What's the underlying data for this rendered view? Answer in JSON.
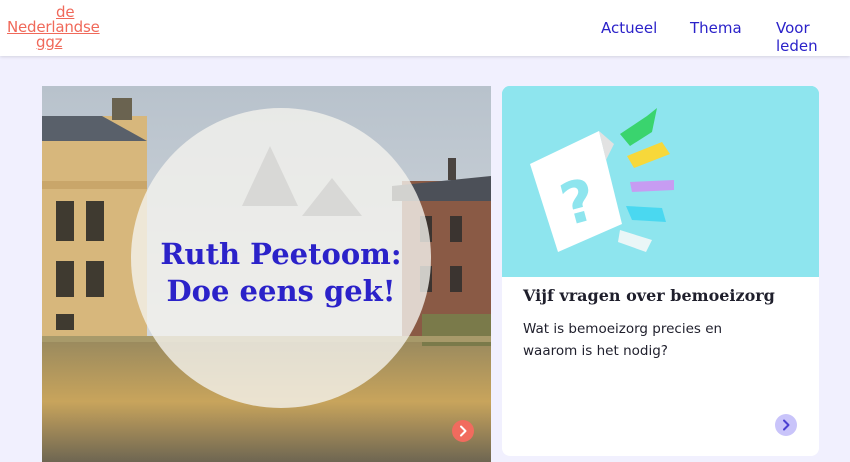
{
  "site": {
    "logo_lines": [
      "de",
      "Nederlandse",
      "ggz"
    ]
  },
  "nav": {
    "items": [
      {
        "label": "Actueel"
      },
      {
        "label": "Thema"
      },
      {
        "label": "Voor leden"
      }
    ]
  },
  "hero": {
    "title": "Ruth Peetoom: Doe eens gek!",
    "arrow_icon": "chevron-right-icon",
    "arrow_color": "#f16b5e"
  },
  "card": {
    "title": "Vijf vragen over bemoeizorg",
    "text": "Wat is bemoeizorg precies en waarom is het nodig?",
    "image_icon": "question-mark-icon",
    "arrow_icon": "chevron-right-icon",
    "arrow_color": "#c9c4fa"
  },
  "colors": {
    "brand_coral": "#f0695a",
    "nav_blue": "#2b22c9",
    "page_bg": "#f1f0fe"
  }
}
